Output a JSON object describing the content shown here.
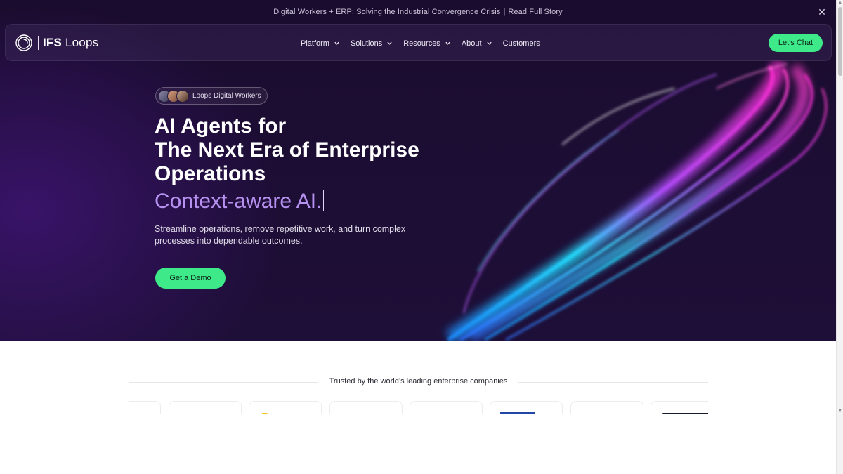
{
  "announcement": {
    "text": "Digital Workers + ERP: Solving the Industrial Convergence Crisis",
    "separator": "|",
    "link": "Read Full Story"
  },
  "close_icon": "close-icon",
  "brand": {
    "name_bold": "IFS",
    "name_rest": "Loops"
  },
  "nav": {
    "items": [
      {
        "label": "Platform",
        "has_dropdown": true
      },
      {
        "label": "Solutions",
        "has_dropdown": true
      },
      {
        "label": "Resources",
        "has_dropdown": true
      },
      {
        "label": "About",
        "has_dropdown": true
      },
      {
        "label": "Customers",
        "has_dropdown": false
      }
    ],
    "cta": "Let's Chat"
  },
  "hero": {
    "pill": "Loops Digital Workers",
    "headline": [
      "AI Agents for",
      "The Next Era of Enterprise",
      "Operations"
    ],
    "typed": "Context-aware AI.",
    "subtitle": "Streamline operations, remove repetitive work, and turn complex processes into dependable outcomes.",
    "cta": "Get a Demo"
  },
  "trusted": {
    "title": "Trusted by the world’s leading enterprise companies"
  },
  "colors": {
    "accent": "#3ee98a",
    "typed_text": "#b691f0",
    "hero_bg": "#1c0d33"
  }
}
